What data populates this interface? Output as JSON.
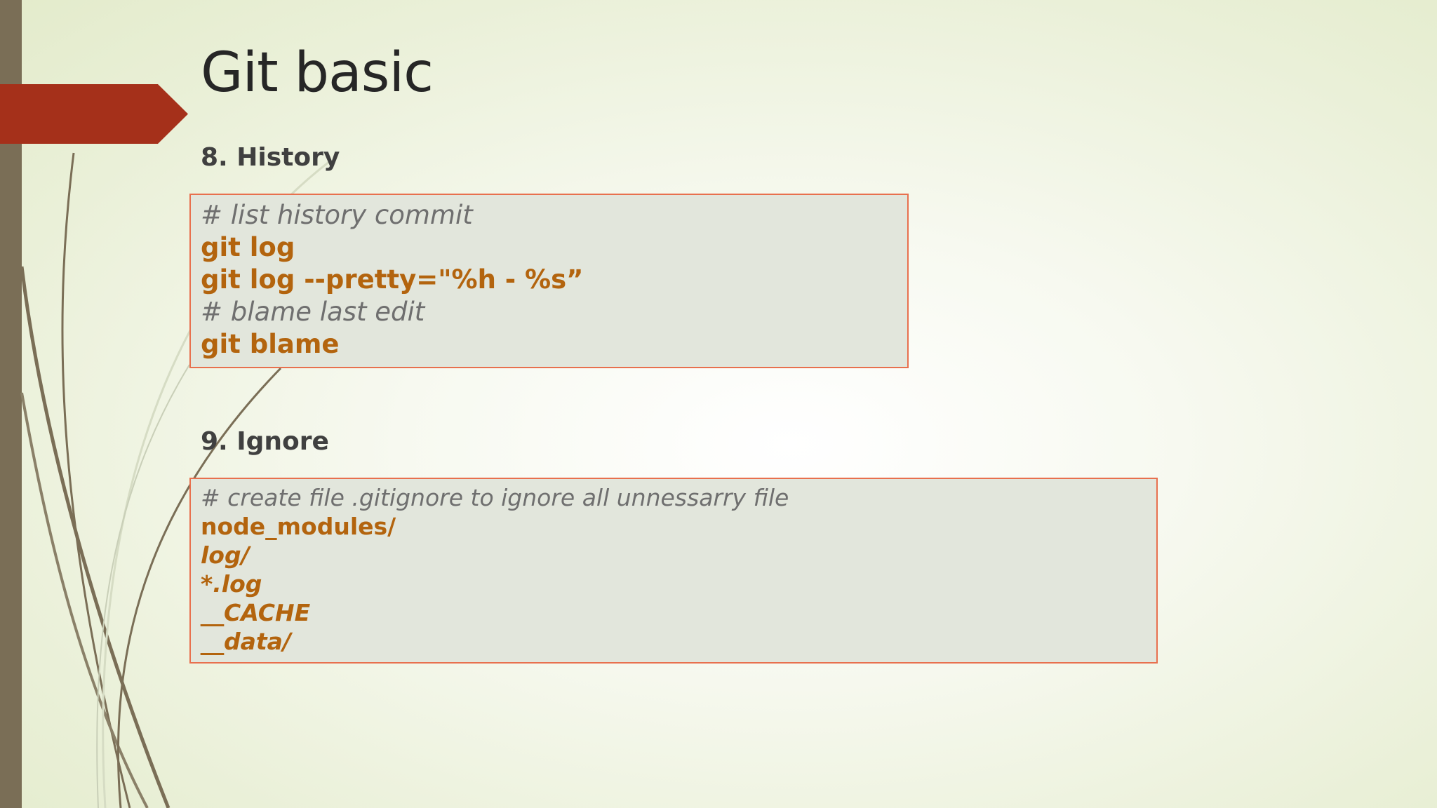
{
  "slide": {
    "title": "Git basic"
  },
  "sections": {
    "history": {
      "heading": "8. History",
      "lines": [
        "# list history commit",
        "git log",
        "git log --pretty=\"%h - %s”",
        "# blame last edit",
        "git blame"
      ]
    },
    "ignore": {
      "heading": "9. Ignore",
      "lines": [
        "# create file .gitignore to ignore all unnessarry file",
        "node_modules/",
        "log/",
        "*.log",
        "__CACHE",
        "__data/"
      ]
    }
  },
  "colors": {
    "accent_arrow": "#a5301a",
    "left_bar": "#7a6e56",
    "box_border": "#e8704e",
    "box_fill": "#e2e6dc",
    "command_text": "#b3640e",
    "comment_text": "#6f6f6f",
    "title_text": "#262626"
  }
}
